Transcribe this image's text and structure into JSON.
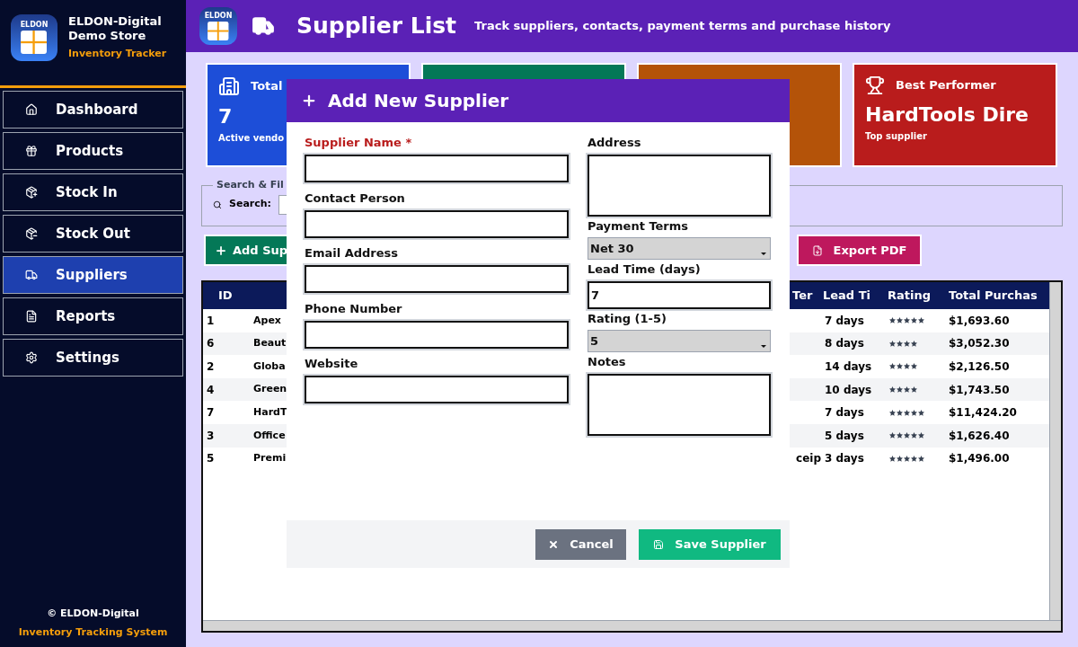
{
  "sidebar": {
    "logo_text": "ELDON",
    "name": "ELDON-Digital",
    "store": "Demo Store",
    "subtitle": "Inventory Tracker",
    "nav": [
      {
        "kind": "home",
        "label": "Dashboard",
        "selected": false
      },
      {
        "kind": "gift",
        "label": "Products",
        "selected": false
      },
      {
        "kind": "in",
        "label": "Stock In",
        "selected": false
      },
      {
        "kind": "out",
        "label": "Stock Out",
        "selected": false
      },
      {
        "kind": "truck",
        "label": "Suppliers",
        "selected": true
      },
      {
        "kind": "report",
        "label": "Reports",
        "selected": false
      },
      {
        "kind": "settings",
        "label": "Settings",
        "selected": false
      }
    ],
    "footer": {
      "copyright": "© ELDON-Digital",
      "system": "Inventory Tracking System"
    }
  },
  "header": {
    "logo_text": "ELDON",
    "title": "Supplier List",
    "subtitle": "Track suppliers, contacts, payment terms and purchase history"
  },
  "stat_cards": [
    {
      "kind": "count",
      "label": "Total",
      "value": "7",
      "caption": "Active vendo",
      "color": "#1d4ed8"
    },
    {
      "kind": "blank",
      "color": "#047857"
    },
    {
      "kind": "blank",
      "color": "#b45309"
    },
    {
      "kind": "award",
      "label": "Best Performer",
      "value": "HardTools Dire",
      "caption": "Top supplier",
      "color": "#b91c1c"
    }
  ],
  "search": {
    "legend": "Search & Fil",
    "label": "Search:"
  },
  "buttons": [
    {
      "kind": "add",
      "label": "Add Sup"
    },
    {
      "kind": "export",
      "label": "Export PDF"
    }
  ],
  "table": {
    "columns": [
      "ID",
      "Ter",
      "Lead Ti",
      "Rating",
      "Total Purchas"
    ],
    "rows": [
      {
        "id": "1",
        "name": "Apex",
        "lead": "7 days",
        "stars": 5,
        "total": "$1,693.60"
      },
      {
        "id": "6",
        "name": "Beaut",
        "lead": "8 days",
        "stars": 4,
        "total": "$3,052.30"
      },
      {
        "id": "2",
        "name": "Globa",
        "lead": "14 days",
        "stars": 4,
        "total": "$2,126.50"
      },
      {
        "id": "4",
        "name": "Green",
        "lead": "10 days",
        "stars": 4,
        "total": "$1,743.50"
      },
      {
        "id": "7",
        "name": "HardT",
        "lead": "7 days",
        "stars": 5,
        "total": "$11,424.20"
      },
      {
        "id": "3",
        "name": "Office",
        "lead": "5 days",
        "stars": 5,
        "total": "$1,626.40"
      },
      {
        "id": "5",
        "name": "Premi",
        "terms": "ceip",
        "lead": "3 days",
        "stars": 5,
        "total": "$1,496.00"
      }
    ]
  },
  "dialog": {
    "title": "Add New Supplier",
    "left_fields": [
      {
        "kind": "text",
        "label": "Supplier Name *",
        "required": true
      },
      {
        "kind": "text",
        "label": "Contact Person",
        "required": false
      },
      {
        "kind": "text",
        "label": "Email Address",
        "required": false
      },
      {
        "kind": "text",
        "label": "Phone Number",
        "required": false
      },
      {
        "kind": "text",
        "label": "Website",
        "required": false
      }
    ],
    "right_fields": [
      {
        "kind": "textarea",
        "label": "Address"
      },
      {
        "kind": "select",
        "label": "Payment Terms",
        "value": "Net 30"
      },
      {
        "kind": "text",
        "label": "Lead Time (days)",
        "value": "7"
      },
      {
        "kind": "select",
        "label": "Rating (1-5)",
        "value": "5"
      },
      {
        "kind": "textarea",
        "label": "Notes"
      }
    ],
    "buttons": [
      {
        "kind": "cancel",
        "label": "Cancel"
      },
      {
        "kind": "save",
        "label": "Save Supplier"
      }
    ]
  }
}
